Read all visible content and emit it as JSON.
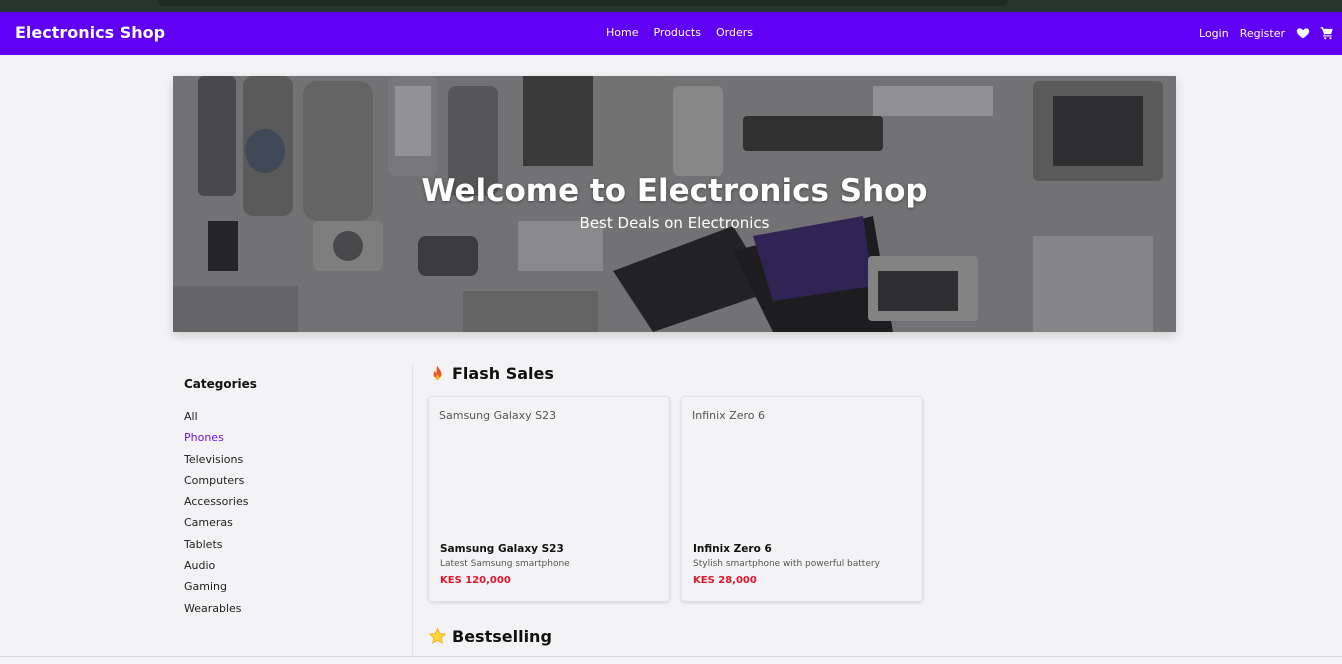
{
  "navbar": {
    "brand": "Electronics Shop",
    "links": [
      "Home",
      "Products",
      "Orders"
    ],
    "login": "Login",
    "register": "Register",
    "icons": [
      "heart-icon",
      "cart-icon"
    ],
    "bg_color": "#5f00f5"
  },
  "hero": {
    "title": "Welcome to Electronics Shop",
    "subtitle": "Best Deals on Electronics"
  },
  "sidebar": {
    "heading": "Categories",
    "items": [
      "All",
      "Phones",
      "Televisions",
      "Computers",
      "Accessories",
      "Cameras",
      "Tablets",
      "Audio",
      "Gaming",
      "Wearables"
    ],
    "active": "Phones"
  },
  "flash_sales": {
    "title": "Flash Sales",
    "icon": "fire-icon",
    "products": [
      {
        "image_alt": "Samsung Galaxy S23",
        "name": "Samsung Galaxy S23",
        "description": "Latest Samsung smartphone",
        "price": "KES 120,000"
      },
      {
        "image_alt": "Infinix Zero 6",
        "name": "Infinix Zero 6",
        "description": "Stylish smartphone with powerful battery",
        "price": "KES 28,000"
      }
    ]
  },
  "bestselling": {
    "title": "Bestselling",
    "icon": "star-icon"
  },
  "colors": {
    "accent": "#5f00f5",
    "active_category": "#6a16e0",
    "price": "#e0162b"
  }
}
